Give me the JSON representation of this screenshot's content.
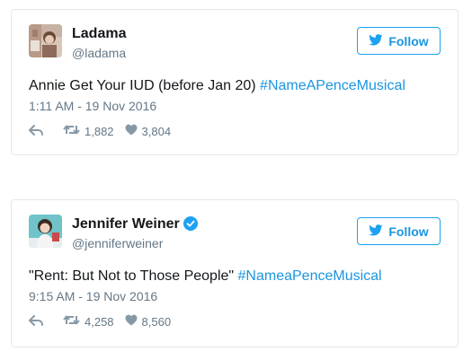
{
  "tweets": [
    {
      "user": {
        "name": "Ladama",
        "handle": "@ladama",
        "verified": false
      },
      "follow_label": "Follow",
      "text": "Annie Get Your IUD (before Jan 20) ",
      "hashtag": "#NameAPenceMusical",
      "timestamp": "1:11 AM - 19 Nov 2016",
      "retweets": "1,882",
      "likes": "3,804"
    },
    {
      "user": {
        "name": "Jennifer Weiner",
        "handle": "@jenniferweiner",
        "verified": true
      },
      "follow_label": "Follow",
      "text": "\"Rent: But Not to Those People\" ",
      "hashtag": "#NameaPenceMusical",
      "timestamp": "9:15 AM - 19 Nov 2016",
      "retweets": "4,258",
      "likes": "8,560"
    }
  ],
  "icons": {
    "bird": "twitter-bird-icon",
    "reply": "reply-icon",
    "retweet": "retweet-icon",
    "like": "heart-icon",
    "verified": "verified-badge-icon"
  },
  "colors": {
    "accent": "#1da1f2",
    "link": "#1b95e0",
    "text": "#14171a",
    "muted": "#657786",
    "border": "#e1e8ed"
  }
}
